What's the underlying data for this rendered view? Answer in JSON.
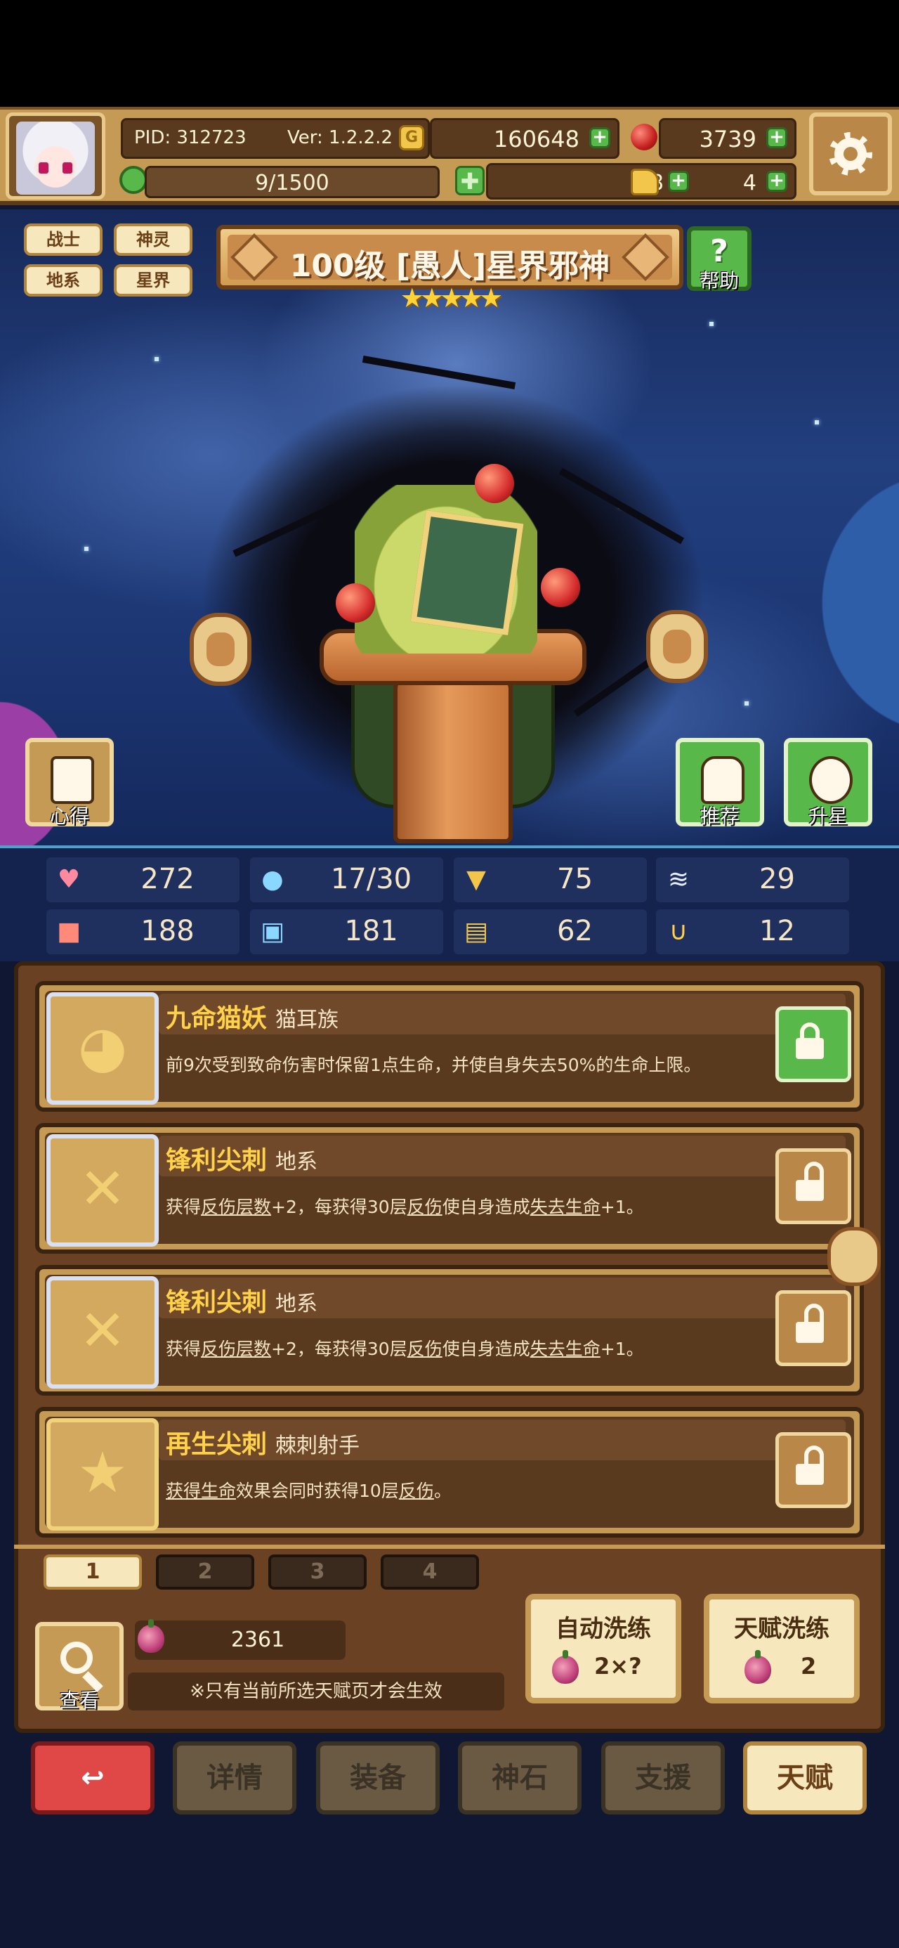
{
  "header": {
    "pid": "PID: 312723",
    "version": "Ver: 1.2.2.2",
    "gold": "160648",
    "red_gems": "3739",
    "energy": "9/1500",
    "clover": "8",
    "key": "4"
  },
  "hero": {
    "tags": [
      "战士",
      "神灵",
      "地系",
      "星界"
    ],
    "title": "100级 [愚人]星界邪神",
    "stars": 5,
    "help_label": "帮助",
    "xinde_label": "心得",
    "recommend_label": "推荐",
    "upgrade_label": "升星"
  },
  "stats": {
    "hp": "272",
    "mana": "17/30",
    "armor": "75",
    "speed": "29",
    "attack": "188",
    "magic": "181",
    "defense_book": "62",
    "luck": "12"
  },
  "talents": [
    {
      "name": "九命猫妖",
      "type": "猫耳族",
      "desc": "前9次受到致命伤害时保留1点生命，并使自身失去50%的生命上限。",
      "locked": true,
      "icon": "cat-icon"
    },
    {
      "name": "锋利尖刺",
      "type": "地系",
      "desc_parts": [
        "获得",
        "反伤层数",
        "+2，每获得30层",
        "反伤",
        "使自身造成",
        "失去生命",
        "+1。"
      ],
      "locked": false,
      "icon": "spikes-icon"
    },
    {
      "name": "锋利尖刺",
      "type": "地系",
      "desc_parts": [
        "获得",
        "反伤层数",
        "+2，每获得30层",
        "反伤",
        "使自身造成",
        "失去生命",
        "+1。"
      ],
      "locked": false,
      "icon": "spikes-icon"
    },
    {
      "name": "再生尖刺",
      "type": "棘刺射手",
      "desc_parts": [
        "获得生命",
        "效果会同时获得10层",
        "反伤",
        "。"
      ],
      "locked": false,
      "icon": "star-icon"
    }
  ],
  "pages": [
    "1",
    "2",
    "3",
    "4"
  ],
  "footer": {
    "search_label": "查看",
    "fruit_count": "2361",
    "notice": "※只有当前所选天赋页才会生效",
    "auto_refine_label": "自动洗练",
    "auto_refine_cost": "2×?",
    "talent_refine_label": "天赋洗练",
    "talent_refine_cost": "2"
  },
  "nav": {
    "details": "详情",
    "equip": "装备",
    "godstone": "神石",
    "support": "支援",
    "talent": "天赋"
  },
  "colors": {
    "accent_gold": "#ffd24a",
    "panel_brown": "#6a4123",
    "plus_green": "#58b84a",
    "back_red": "#e04848"
  }
}
